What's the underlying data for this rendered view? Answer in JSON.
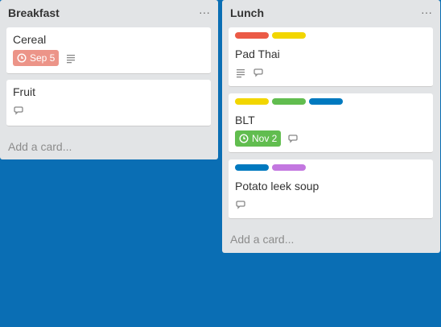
{
  "lists": [
    {
      "title": "Breakfast",
      "menu": "···",
      "add_card": "Add a card...",
      "cards": [
        {
          "title": "Cereal",
          "due": "Sep 5",
          "due_color": "#ec9488"
        },
        {
          "title": "Fruit"
        }
      ]
    },
    {
      "title": "Lunch",
      "menu": "···",
      "add_card": "Add a card...",
      "cards": [
        {
          "title": "Pad Thai",
          "labels": [
            "#eb5a46",
            "#f2d600"
          ]
        },
        {
          "title": "BLT",
          "labels": [
            "#f2d600",
            "#61bd4f",
            "#0079bf"
          ],
          "due": "Nov 2",
          "due_color": "#61bd4f"
        },
        {
          "title": "Potato leek soup",
          "labels": [
            "#0079bf",
            "#c377e0"
          ]
        }
      ]
    }
  ]
}
